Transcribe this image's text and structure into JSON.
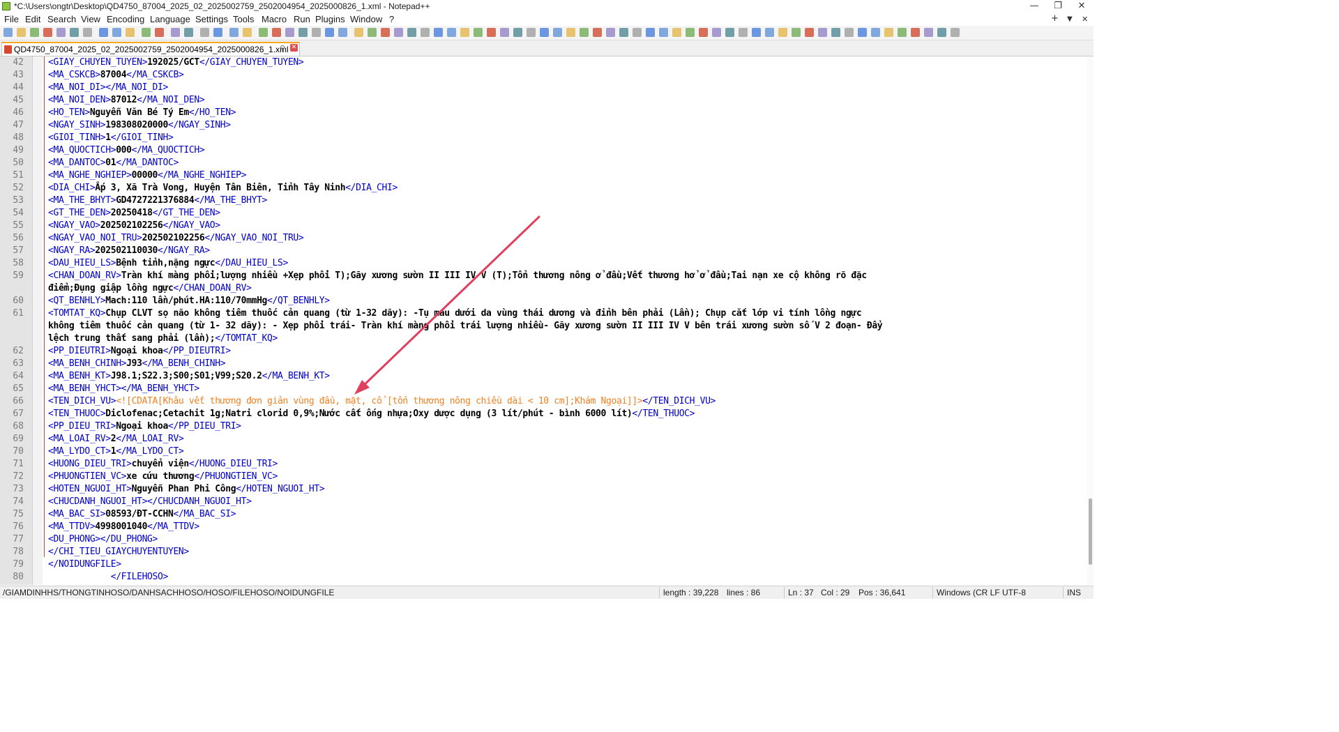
{
  "window": {
    "title": "*C:\\Users\\ongtr\\Desktop\\QD4750_87004_2025_02_2025002759_2502004954_2025000826_1.xml - Notepad++",
    "minimize": "—",
    "maximize": "❐",
    "close": "✕"
  },
  "menu": {
    "items": [
      "File",
      "Edit",
      "Search",
      "View",
      "Encoding",
      "Language",
      "Settings",
      "Tools",
      "Macro",
      "Run",
      "Plugins",
      "Window",
      "?"
    ],
    "right": [
      "+",
      "▼",
      "✕"
    ]
  },
  "tab": {
    "label": "QD4750_87004_2025_02_2025002759_2502004954_2025000826_1.xml",
    "pin": "⚲",
    "close": "✕"
  },
  "editor": {
    "lines": [
      {
        "n": "42",
        "parts": [
          [
            "t",
            "<GIAY_CHUYEN_TUYEN>"
          ],
          [
            "v",
            "192025/GCT"
          ],
          [
            "t",
            "</GIAY_CHUYEN_TUYEN>"
          ]
        ]
      },
      {
        "n": "43",
        "parts": [
          [
            "t",
            "<MA_CSKCB>"
          ],
          [
            "v",
            "87004"
          ],
          [
            "t",
            "</MA_CSKCB>"
          ]
        ]
      },
      {
        "n": "44",
        "parts": [
          [
            "t",
            "<MA_NOI_DI></MA_NOI_DI>"
          ]
        ]
      },
      {
        "n": "45",
        "parts": [
          [
            "t",
            "<MA_NOI_DEN>"
          ],
          [
            "v",
            "87012"
          ],
          [
            "t",
            "</MA_NOI_DEN>"
          ]
        ]
      },
      {
        "n": "46",
        "parts": [
          [
            "t",
            "<HO_TEN>"
          ],
          [
            "v",
            "Nguyễn Văn Bé Tý Em"
          ],
          [
            "t",
            "</HO_TEN>"
          ]
        ]
      },
      {
        "n": "47",
        "parts": [
          [
            "t",
            "<NGAY_SINH>"
          ],
          [
            "v",
            "198308020000"
          ],
          [
            "t",
            "</NGAY_SINH>"
          ]
        ]
      },
      {
        "n": "48",
        "parts": [
          [
            "t",
            "<GIOI_TINH>"
          ],
          [
            "v",
            "1"
          ],
          [
            "t",
            "</GIOI_TINH>"
          ]
        ]
      },
      {
        "n": "49",
        "parts": [
          [
            "t",
            "<MA_QUOCTICH>"
          ],
          [
            "v",
            "000"
          ],
          [
            "t",
            "</MA_QUOCTICH>"
          ]
        ]
      },
      {
        "n": "50",
        "parts": [
          [
            "t",
            "<MA_DANTOC>"
          ],
          [
            "v",
            "01"
          ],
          [
            "t",
            "</MA_DANTOC>"
          ]
        ]
      },
      {
        "n": "51",
        "parts": [
          [
            "t",
            "<MA_NGHE_NGHIEP>"
          ],
          [
            "v",
            "00000"
          ],
          [
            "t",
            "</MA_NGHE_NGHIEP>"
          ]
        ]
      },
      {
        "n": "52",
        "parts": [
          [
            "t",
            "<DIA_CHI>"
          ],
          [
            "v",
            "Ấp 3, Xã Trà Vong, Huyện Tân Biên, Tỉnh Tây Ninh"
          ],
          [
            "t",
            "</DIA_CHI>"
          ]
        ]
      },
      {
        "n": "53",
        "parts": [
          [
            "t",
            "<MA_THE_BHYT>"
          ],
          [
            "v",
            "GD4727221376884"
          ],
          [
            "t",
            "</MA_THE_BHYT>"
          ]
        ]
      },
      {
        "n": "54",
        "parts": [
          [
            "t",
            "<GT_THE_DEN>"
          ],
          [
            "v",
            "20250418"
          ],
          [
            "t",
            "</GT_THE_DEN>"
          ]
        ]
      },
      {
        "n": "55",
        "parts": [
          [
            "t",
            "<NGAY_VAO>"
          ],
          [
            "v",
            "202502102256"
          ],
          [
            "t",
            "</NGAY_VAO>"
          ]
        ]
      },
      {
        "n": "56",
        "parts": [
          [
            "t",
            "<NGAY_VAO_NOI_TRU>"
          ],
          [
            "v",
            "202502102256"
          ],
          [
            "t",
            "</NGAY_VAO_NOI_TRU>"
          ]
        ]
      },
      {
        "n": "57",
        "parts": [
          [
            "t",
            "<NGAY_RA>"
          ],
          [
            "v",
            "202502110030"
          ],
          [
            "t",
            "</NGAY_RA>"
          ]
        ]
      },
      {
        "n": "58",
        "parts": [
          [
            "t",
            "<DAU_HIEU_LS>"
          ],
          [
            "v",
            "Bệnh tỉnh,nặng ngực"
          ],
          [
            "t",
            "</DAU_HIEU_LS>"
          ]
        ]
      },
      {
        "n": "59",
        "parts": [
          [
            "t",
            "<CHAN_DOAN_RV>"
          ],
          [
            "v",
            "Tràn khí màng phổi;lượng nhiều +Xẹp phổi T);Gãy xương sườn II III IV V (T);Tổn thương nông ở đầu;Vết thương hở ở đầu;Tai nạn xe cộ không rõ đặc"
          ]
        ]
      },
      {
        "n": "",
        "parts": [
          [
            "v",
            "điểm;Đụng giập lồng ngực"
          ],
          [
            "t",
            "</CHAN_DOAN_RV>"
          ]
        ]
      },
      {
        "n": "60",
        "parts": [
          [
            "t",
            "<QT_BENHLY>"
          ],
          [
            "v",
            "Mach:110 lần/phút.HA:110/70mmHg"
          ],
          [
            "t",
            "</QT_BENHLY>"
          ]
        ]
      },
      {
        "n": "61",
        "parts": [
          [
            "t",
            "<TOMTAT_KQ>"
          ],
          [
            "v",
            "Chụp CLVT sọ não không tiêm thuốc cản quang (từ 1-32 dãy): -Tụ máu dưới da vùng thái dương và đỉnh bên phải (Lần); Chụp cắt lớp vi tính lồng ngực"
          ]
        ]
      },
      {
        "n": "",
        "parts": [
          [
            "v",
            "không tiêm thuốc cản quang (từ 1- 32 dãy): - Xẹp phổi trái- Tràn khí màng phổi trái lượng nhiều- Gãy xương sườn II III IV V bên trái xương sườn số V 2 đoạn- Đẩy"
          ]
        ]
      },
      {
        "n": "",
        "parts": [
          [
            "v",
            "lệch trung thất sang phải (lần);"
          ],
          [
            "t",
            "</TOMTAT_KQ>"
          ]
        ]
      },
      {
        "n": "62",
        "parts": [
          [
            "t",
            "<PP_DIEUTRI>"
          ],
          [
            "v",
            "Ngoại khoa"
          ],
          [
            "t",
            "</PP_DIEUTRI>"
          ]
        ]
      },
      {
        "n": "63",
        "parts": [
          [
            "t",
            "<MA_BENH_CHINH>"
          ],
          [
            "v",
            "J93"
          ],
          [
            "t",
            "</MA_BENH_CHINH>"
          ]
        ]
      },
      {
        "n": "64",
        "parts": [
          [
            "t",
            "<MA_BENH_KT>"
          ],
          [
            "v",
            "J98.1;S22.3;S00;S01;V99;S20.2"
          ],
          [
            "t",
            "</MA_BENH_KT>"
          ]
        ]
      },
      {
        "n": "65",
        "parts": [
          [
            "t",
            "<MA_BENH_YHCT></MA_BENH_YHCT>"
          ]
        ]
      },
      {
        "n": "66",
        "parts": [
          [
            "t",
            "<TEN_DICH_VU>"
          ],
          [
            "c",
            "<![CDATA[Khâu vết thương đơn giản vùng đầu, mặt, cổ [tổn thương nông chiều dài < 10 cm];Khám Ngoại]]>"
          ],
          [
            "t",
            "</TEN_DICH_VU>"
          ]
        ]
      },
      {
        "n": "67",
        "parts": [
          [
            "t",
            "<TEN_THUOC>"
          ],
          [
            "v",
            "Diclofenac;Cetachit 1g;Natri clorid 0,9%;Nước cất ống nhựa;Oxy dược dụng (3 lít/phút - bình 6000 lít)"
          ],
          [
            "t",
            "</TEN_THUOC>"
          ]
        ]
      },
      {
        "n": "68",
        "parts": [
          [
            "t",
            "<PP_DIEU_TRI>"
          ],
          [
            "v",
            "Ngoại khoa"
          ],
          [
            "t",
            "</PP_DIEU_TRI>"
          ]
        ]
      },
      {
        "n": "69",
        "parts": [
          [
            "t",
            "<MA_LOAI_RV>"
          ],
          [
            "v",
            "2"
          ],
          [
            "t",
            "</MA_LOAI_RV>"
          ]
        ]
      },
      {
        "n": "70",
        "parts": [
          [
            "t",
            "<MA_LYDO_CT>"
          ],
          [
            "v",
            "1"
          ],
          [
            "t",
            "</MA_LYDO_CT>"
          ]
        ]
      },
      {
        "n": "71",
        "parts": [
          [
            "t",
            "<HUONG_DIEU_TRI>"
          ],
          [
            "v",
            "chuyển viện"
          ],
          [
            "t",
            "</HUONG_DIEU_TRI>"
          ]
        ]
      },
      {
        "n": "72",
        "parts": [
          [
            "t",
            "<PHUONGTIEN_VC>"
          ],
          [
            "v",
            "xe cứu thương"
          ],
          [
            "t",
            "</PHUONGTIEN_VC>"
          ]
        ]
      },
      {
        "n": "73",
        "parts": [
          [
            "t",
            "<HOTEN_NGUOI_HT>"
          ],
          [
            "v",
            "Nguyễn Phan Phi Công"
          ],
          [
            "t",
            "</HOTEN_NGUOI_HT>"
          ]
        ]
      },
      {
        "n": "74",
        "parts": [
          [
            "t",
            "<CHUCDANH_NGUOI_HT></CHUCDANH_NGUOI_HT>"
          ]
        ]
      },
      {
        "n": "75",
        "parts": [
          [
            "t",
            "<MA_BAC_SI>"
          ],
          [
            "v",
            "08593/ĐT-CCHN"
          ],
          [
            "t",
            "</MA_BAC_SI>"
          ]
        ]
      },
      {
        "n": "76",
        "parts": [
          [
            "t",
            "<MA_TTDV>"
          ],
          [
            "v",
            "4998001040"
          ],
          [
            "t",
            "</MA_TTDV>"
          ]
        ]
      },
      {
        "n": "77",
        "parts": [
          [
            "t",
            "<DU_PHONG></DU_PHONG>"
          ]
        ]
      },
      {
        "n": "78",
        "parts": [
          [
            "t",
            "</CHI_TIEU_GIAYCHUYENTUYEN>"
          ]
        ]
      },
      {
        "n": "79",
        "parts": [
          [
            "t",
            "</NOIDUNGFILE>"
          ]
        ]
      },
      {
        "n": "80",
        "parts": [
          [
            "t",
            "            </FILEHOSO>"
          ]
        ]
      }
    ]
  },
  "statusbar": {
    "path": "/GIAMDINHHS/THONGTINHOSO/DANHSACHHOSO/HOSO/FILEHOSO/NOIDUNGFILE",
    "length": "length : 39,228",
    "lines": "lines : 86",
    "ln": "Ln : 37",
    "col": "Col : 29",
    "pos": "Pos : 36,641",
    "eol_encoding": "Windows (CR LF UTF-8",
    "mode": "INS"
  },
  "colors": {
    "tag": "#0000c8",
    "value": "#000000",
    "cdata": "#f08020",
    "arrow": "#e0405e",
    "tab_accent": "#f5a623"
  }
}
